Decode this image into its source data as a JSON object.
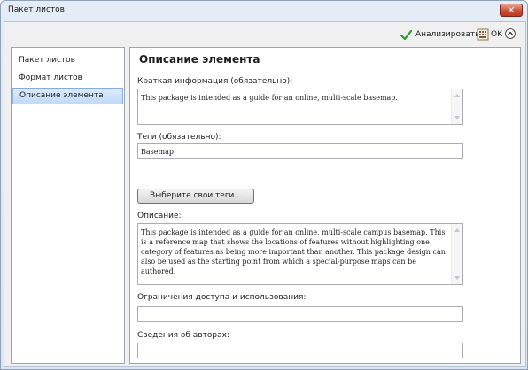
{
  "window": {
    "title": "Пакет листов",
    "close_label": "✕"
  },
  "toolbar": {
    "analyze_label": "Анализировать",
    "ok_label": "OK"
  },
  "sidebar": {
    "items": [
      {
        "label": "Пакет листов"
      },
      {
        "label": "Формат листов"
      },
      {
        "label": "Описание элемента",
        "selected": true
      }
    ]
  },
  "main": {
    "section_title": "Описание элемента",
    "summary_label": "Краткая информация (обязательно):",
    "summary_value": "This package is intended as a guide for an online, multi-scale basemap.",
    "tags_label": "Теги (обязательно):",
    "tags_value": "Basemap",
    "tags_button": "Выберите свои теги...",
    "description_label": "Описание:",
    "description_value": "This package is intended as a guide for an online, multi-scale campus basemap. This is a reference map that shows the locations of features without highlighting one category of features as being more important than another. This package design can also be used as the starting point from which a special-purpose maps can be authored.",
    "access_label": "Ограничения доступа и использования:",
    "access_value": "",
    "credits_label": "Сведения об авторах:",
    "credits_value": ""
  },
  "icons": {
    "analyze": "checkmark-icon",
    "ok": "package-icon",
    "collapse": "chevron-up-icon",
    "close": "close-icon"
  },
  "colors": {
    "title_bar": "#dbe6f2",
    "close_button": "#cd4d34",
    "selected_item": "#c1dbfa",
    "check_green": "#2e9b2e"
  }
}
